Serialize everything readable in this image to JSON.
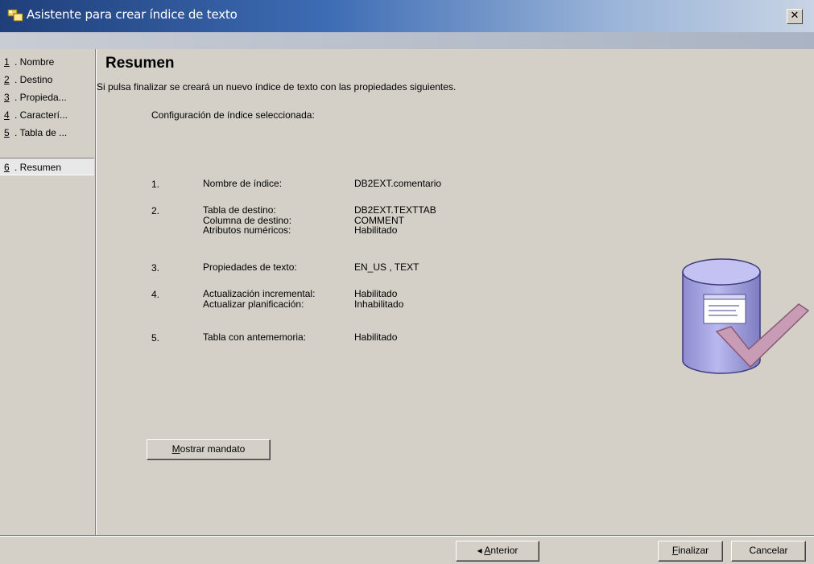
{
  "window": {
    "title": "Asistente para crear índice de texto",
    "close_label": "✕"
  },
  "nav": {
    "items": [
      {
        "num": "1",
        "label": ". Nombre"
      },
      {
        "num": "2",
        "label": ". Destino"
      },
      {
        "num": "3",
        "label": ". Propieda..."
      },
      {
        "num": "4",
        "label": ". Caracterí..."
      },
      {
        "num": "5",
        "label": ". Tabla de ..."
      },
      {
        "num": "6",
        "label": ". Resumen"
      }
    ],
    "active_index": 5
  },
  "main": {
    "heading": "Resumen",
    "intro": "Si pulsa finalizar se creará un nuevo índice de texto con las propiedades siguientes.",
    "config_label": "Configuración de índice seleccionada:",
    "summary": [
      {
        "num": "1.",
        "labels": [
          "Nombre de índice:"
        ],
        "values": [
          "DB2EXT.comentario"
        ]
      },
      {
        "num": "2.",
        "labels": [
          "Tabla de destino:",
          "Columna de destino:",
          "Atributos numéricos:"
        ],
        "values": [
          "DB2EXT.TEXTTAB",
          "COMMENT",
          "Habilitado"
        ]
      },
      {
        "num": "3.",
        "labels": [
          "Propiedades de texto:"
        ],
        "values": [
          "EN_US , TEXT"
        ]
      },
      {
        "num": "4.",
        "labels": [
          "Actualización incremental:",
          "Actualizar planificación:"
        ],
        "values": [
          "Habilitado",
          "Inhabilitado"
        ]
      },
      {
        "num": "5.",
        "labels": [
          "Tabla con antememoria:"
        ],
        "values": [
          "Habilitado"
        ]
      }
    ],
    "show_command_mnemonic": "M",
    "show_command_rest": "ostrar mandato"
  },
  "footer": {
    "prev_arrow": "◂",
    "prev_mnemonic": "A",
    "prev_rest": "nterior",
    "finish_mnemonic": "F",
    "finish_rest": "inalizar",
    "cancel_label": "Cancelar"
  },
  "colors": {
    "titlebar_start": "#1f3f7a",
    "window_bg": "#d4d0c8",
    "cylinder": "#a9a8e0",
    "checkmark": "#c89cb4"
  },
  "icons": {
    "app": "wizard-app-icon",
    "close": "close-icon",
    "illustration": "database-check-icon"
  }
}
